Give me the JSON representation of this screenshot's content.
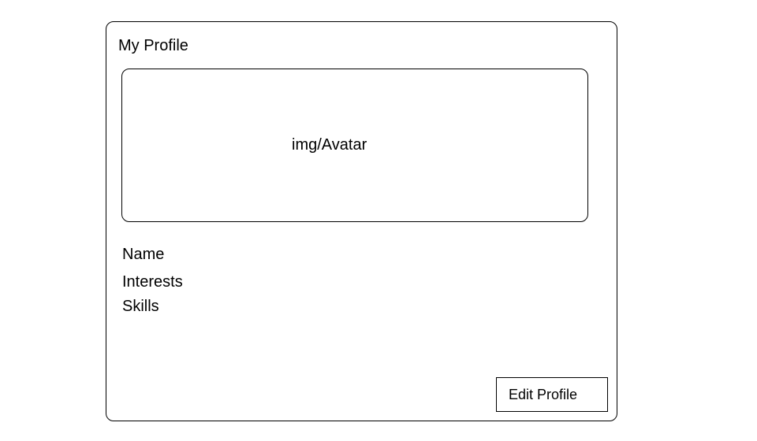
{
  "card": {
    "title": "My Profile",
    "avatar_placeholder": "img/Avatar",
    "fields": {
      "name": "Name",
      "interests": "Interests",
      "skills": "Skills"
    },
    "edit_button_label": "Edit Profile"
  }
}
